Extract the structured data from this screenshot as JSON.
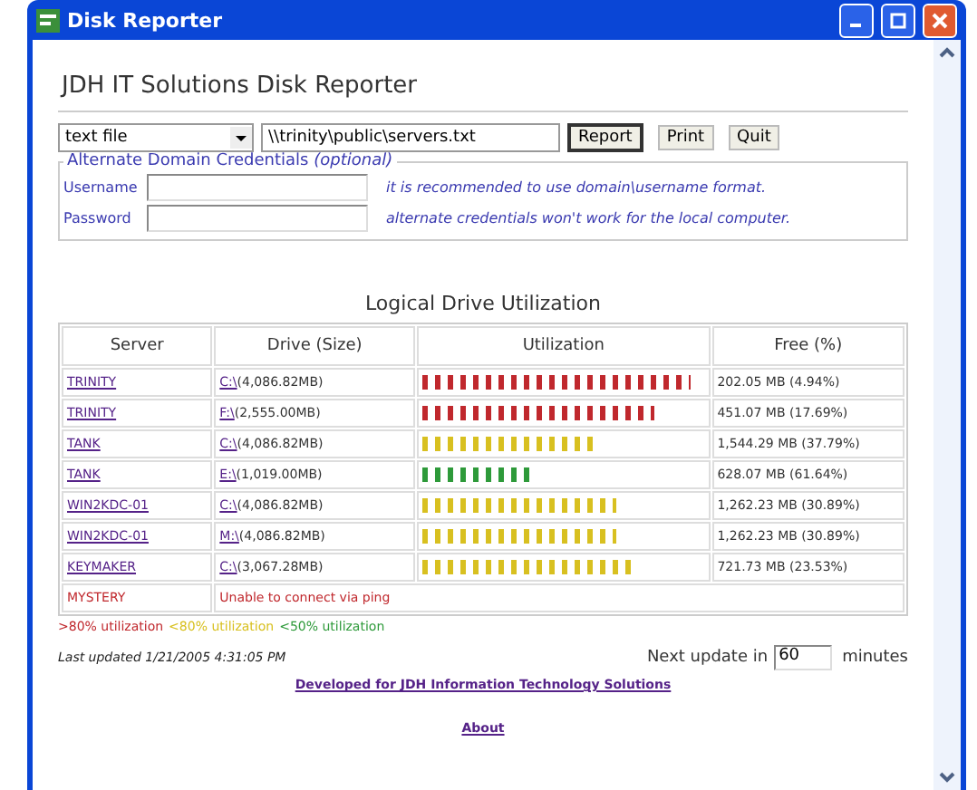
{
  "window": {
    "title": "Disk Reporter"
  },
  "heading": "JDH IT Solutions Disk Reporter",
  "source": {
    "type": "text file",
    "path": "\\\\trinity\\public\\servers.txt"
  },
  "buttons": [
    {
      "label": "Report",
      "selected": true
    },
    {
      "label": "Print",
      "selected": false
    },
    {
      "label": "Quit",
      "selected": false
    }
  ],
  "credentials": {
    "legend": "Alternate Domain Credentials",
    "legend_note": "(optional)",
    "fields": [
      {
        "label": "Username",
        "hint": "it is recommended to use domain\\username format."
      },
      {
        "label": "Password",
        "hint": "alternate credentials won't work for the local computer."
      }
    ]
  },
  "table": {
    "title": "Logical Drive Utilization",
    "columns": [
      "Server",
      "Drive (Size)",
      "Utilization",
      "Free (%)"
    ],
    "rows": [
      {
        "kind": "drive",
        "server": "TRINITY",
        "drive": "C:\\",
        "size": "(4,086.82MB)",
        "level": 0.95,
        "color": "#c0282d",
        "free": "202.05 MB (4.94%)"
      },
      {
        "kind": "drive",
        "server": "TRINITY",
        "drive": "F:\\",
        "size": "(2,555.00MB)",
        "level": 0.82,
        "color": "#c0282d",
        "free": "451.07 MB (17.69%)"
      },
      {
        "kind": "drive",
        "server": "TANK",
        "drive": "C:\\",
        "size": "(4,086.82MB)",
        "level": 0.62,
        "color": "#d8c020",
        "free": "1,544.29 MB (37.79%)"
      },
      {
        "kind": "drive",
        "server": "TANK",
        "drive": "E:\\",
        "size": "(1,019.00MB)",
        "level": 0.38,
        "color": "#2e9a3a",
        "free": "628.07 MB (61.64%)"
      },
      {
        "kind": "drive",
        "server": "WIN2KDC-01",
        "drive": "C:\\",
        "size": "(4,086.82MB)",
        "level": 0.69,
        "color": "#d8c020",
        "free": "1,262.23 MB (30.89%)"
      },
      {
        "kind": "drive",
        "server": "WIN2KDC-01",
        "drive": "M:\\",
        "size": "(4,086.82MB)",
        "level": 0.69,
        "color": "#d8c020",
        "free": "1,262.23 MB (30.89%)"
      },
      {
        "kind": "drive",
        "server": "KEYMAKER",
        "drive": "C:\\",
        "size": "(3,067.28MB)",
        "level": 0.76,
        "color": "#d8c020",
        "free": "721.73 MB (23.53%)"
      },
      {
        "kind": "error",
        "server": "MYSTERY",
        "message": "Unable to connect via ping"
      }
    ]
  },
  "legend": [
    {
      "label": ">80% utilization",
      "color": "#c0282d"
    },
    {
      "label": "<80% utilization",
      "color": "#d8c020"
    },
    {
      "label": "<50% utilization",
      "color": "#2e9a3a"
    }
  ],
  "last_updated": "Last updated 1/21/2005 4:31:05 PM",
  "next_update": {
    "label": "Next update in",
    "value": "60",
    "unit": "minutes"
  },
  "links": [
    "Developed for JDH Information Technology Solutions",
    "About"
  ]
}
